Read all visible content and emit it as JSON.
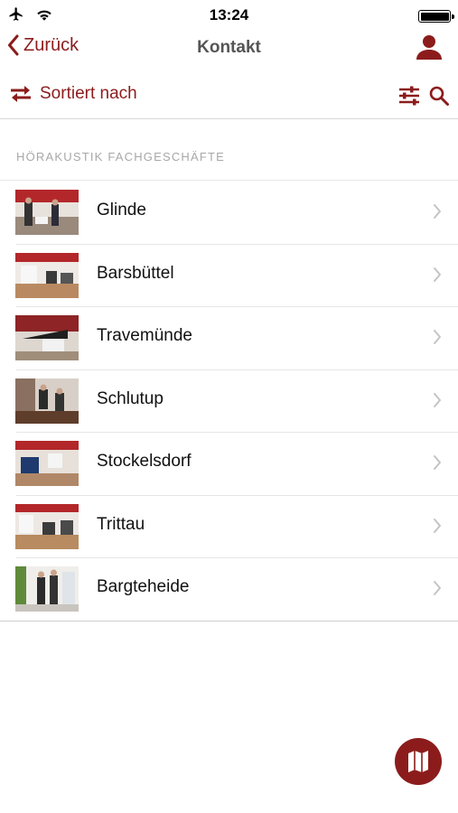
{
  "status_bar": {
    "time": "13:24",
    "icons": [
      "airplane-icon",
      "wifi-icon",
      "battery-icon"
    ]
  },
  "nav": {
    "back_label": "Zurück",
    "title": "Kontakt",
    "profile_icon": "person-icon"
  },
  "toolbar": {
    "sort_label": "Sortiert nach",
    "sort_icon": "swap-arrows-icon",
    "filter_icon": "sliders-icon",
    "search_icon": "search-icon"
  },
  "section": {
    "header": "HÖRAKUSTIK FACHGESCHÄFTE"
  },
  "stores": [
    {
      "name": "Glinde",
      "thumb": "store-photo"
    },
    {
      "name": "Barsbüttel",
      "thumb": "store-photo"
    },
    {
      "name": "Travemünde",
      "thumb": "store-photo"
    },
    {
      "name": "Schlutup",
      "thumb": "store-photo"
    },
    {
      "name": "Stockelsdorf",
      "thumb": "store-photo"
    },
    {
      "name": "Trittau",
      "thumb": "store-photo"
    },
    {
      "name": "Bargteheide",
      "thumb": "store-photo"
    }
  ],
  "fab": {
    "icon": "map-icon"
  },
  "colors": {
    "accent": "#8c1c1c",
    "section_header": "#a8a8a8",
    "separator": "#e6e6e6"
  }
}
